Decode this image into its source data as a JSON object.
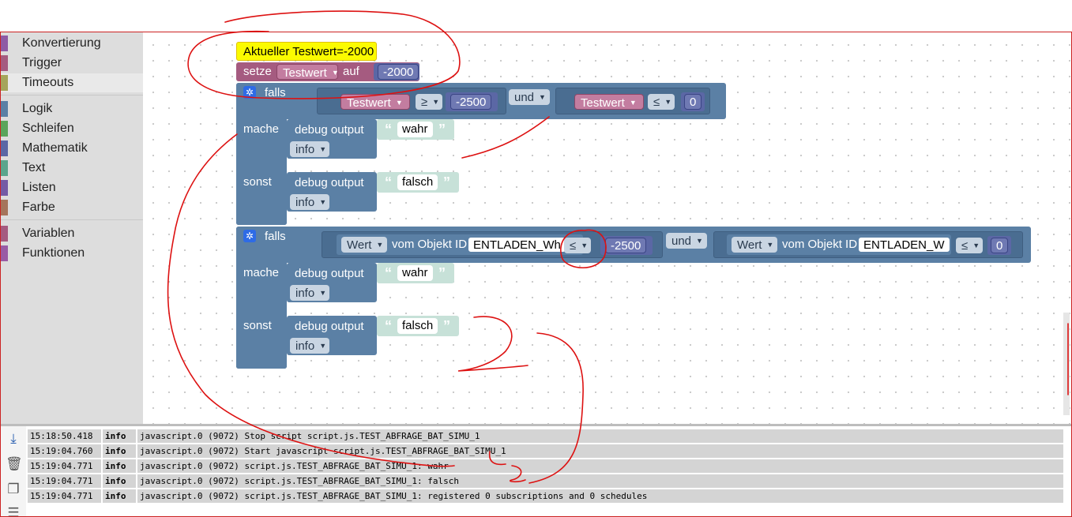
{
  "toolbox": {
    "items": [
      {
        "label": "Konvertierung",
        "color": "#8e5ba5"
      },
      {
        "label": "Trigger",
        "color": "#a55b80"
      },
      {
        "label": "Timeouts",
        "color": "#a5a55b"
      },
      {
        "label": "Logik",
        "color": "#5b80a5"
      },
      {
        "label": "Schleifen",
        "color": "#5ba55b"
      },
      {
        "label": "Mathematik",
        "color": "#5b67a5"
      },
      {
        "label": "Text",
        "color": "#5ba58c"
      },
      {
        "label": "Listen",
        "color": "#745ba5"
      },
      {
        "label": "Farbe",
        "color": "#a5745b"
      },
      {
        "label": "Variablen",
        "color": "#a55b80"
      },
      {
        "label": "Funktionen",
        "color": "#995ba5"
      }
    ]
  },
  "blocks": {
    "comment": "Aktueller Testwert=-2000",
    "set": {
      "kw_setze": "setze",
      "var": "Testwert",
      "kw_auf": "auf",
      "value": "-2000"
    },
    "if1": {
      "kw_falls": "falls",
      "cmp1": {
        "var": "Testwert",
        "op": "≥",
        "value": "-2500"
      },
      "and": "und",
      "cmp2": {
        "var": "Testwert",
        "op": "≤",
        "value": "0"
      },
      "kw_mache": "mache",
      "kw_sonst": "sonst",
      "then": {
        "label": "debug output",
        "text": "wahr",
        "level": "info"
      },
      "else": {
        "label": "debug output",
        "text": "falsch",
        "level": "info"
      }
    },
    "if2": {
      "kw_falls": "falls",
      "cmp1": {
        "prop": "Wert",
        "kw_vom": "vom Objekt ID",
        "id": "ENTLADEN_Wh",
        "op": "≤",
        "value": "-2500"
      },
      "and": "und",
      "cmp2": {
        "prop": "Wert",
        "kw_vom": "vom Objekt ID",
        "id": "ENTLADEN_W",
        "op": "≤",
        "value": "0"
      },
      "kw_mache": "mache",
      "kw_sonst": "sonst",
      "then": {
        "label": "debug output",
        "text": "wahr",
        "level": "info"
      },
      "else": {
        "label": "debug output",
        "text": "falsch",
        "level": "info"
      }
    }
  },
  "console": {
    "icons": [
      "scroll-down-icon",
      "trash-icon",
      "copy-icon",
      "list-icon"
    ],
    "rows": [
      {
        "time": "15:18:50.418",
        "level": "info",
        "msg": "javascript.0 (9072) Stop script script.js.TEST_ABFRAGE_BAT_SIMU_1"
      },
      {
        "time": "15:19:04.760",
        "level": "info",
        "msg": "javascript.0 (9072) Start javascript script.js.TEST_ABFRAGE_BAT_SIMU_1"
      },
      {
        "time": "15:19:04.771",
        "level": "info",
        "msg": "javascript.0 (9072) script.js.TEST_ABFRAGE_BAT_SIMU_1: wahr"
      },
      {
        "time": "15:19:04.771",
        "level": "info",
        "msg": "javascript.0 (9072) script.js.TEST_ABFRAGE_BAT_SIMU_1: falsch"
      },
      {
        "time": "15:19:04.771",
        "level": "info",
        "msg": "javascript.0 (9072) script.js.TEST_ABFRAGE_BAT_SIMU_1: registered 0 subscriptions and 0 schedules"
      }
    ]
  },
  "colors": {
    "annotation": "#dd1111",
    "frame": "#cc2222"
  }
}
